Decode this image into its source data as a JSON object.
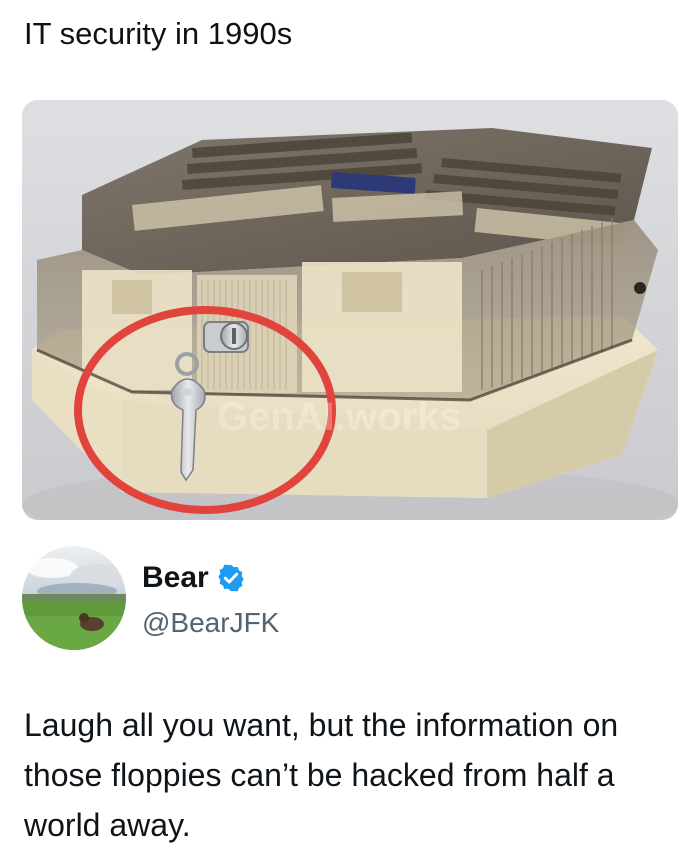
{
  "post": {
    "caption": "IT security in 1990s",
    "image_alt": "Floppy disk storage box with smoked-plastic lid, lock with key circled in red",
    "watermark": "GenAI.works"
  },
  "tweet": {
    "display_name": "Bear",
    "handle": "@BearJFK",
    "verified": true,
    "text": "Laugh all you want, but the information on those floppies can’t be hacked from half a world away."
  },
  "colors": {
    "highlight_circle": "#e0443c",
    "verified_badge": "#1d9bf0",
    "handle_text": "#536471"
  },
  "icons": {
    "verified": "verified-badge-icon"
  }
}
